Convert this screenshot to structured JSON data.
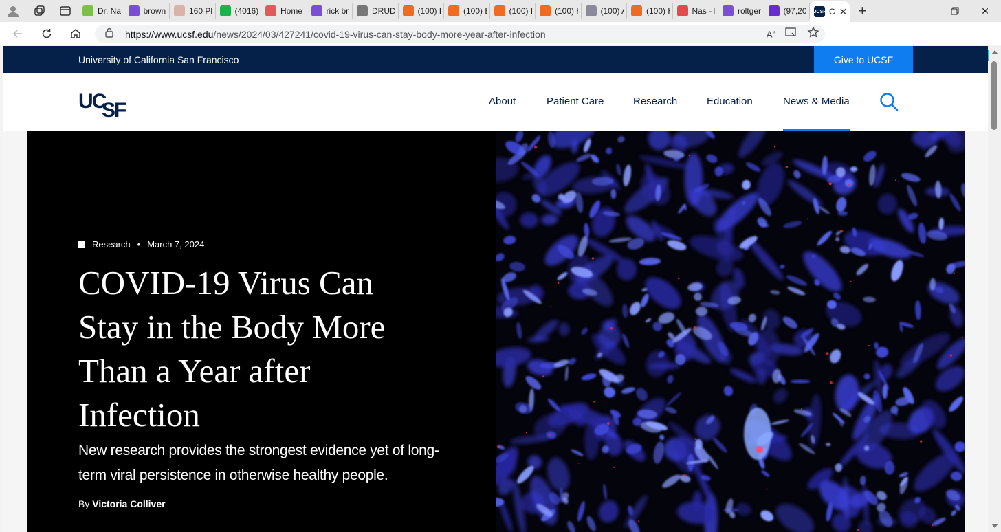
{
  "browser": {
    "tabs": [
      {
        "label": "Dr. Na",
        "color": "#7cc04b"
      },
      {
        "label": "brown",
        "color": "#7b4fd3"
      },
      {
        "label": "160 Pl",
        "color": "#d8b4a8"
      },
      {
        "label": "(4016)",
        "color": "#19b34a"
      },
      {
        "label": "Home",
        "color": "#e05a5a"
      },
      {
        "label": "rick br",
        "color": "#7b4fd3"
      },
      {
        "label": "DRUD",
        "color": "#777777"
      },
      {
        "label": "(100) H",
        "color": "#f06a22"
      },
      {
        "label": "(100) E",
        "color": "#f06a22"
      },
      {
        "label": "(100) H",
        "color": "#f06a22"
      },
      {
        "label": "(100) H",
        "color": "#f06a22"
      },
      {
        "label": "(100) A",
        "color": "#8a8a9a"
      },
      {
        "label": "(100) H",
        "color": "#f06a22"
      },
      {
        "label": "Nas - I",
        "color": "#e34b4b"
      },
      {
        "label": "roltger",
        "color": "#7b4fd3"
      },
      {
        "label": "(97,20",
        "color": "#6a2bd1"
      }
    ],
    "active_tab": {
      "label": "C",
      "favicon_text": "UCSF"
    },
    "url_host": "https://www.ucsf.edu",
    "url_path": "/news/2024/03/427241/covid-19-virus-can-stay-body-more-year-after-infection"
  },
  "site": {
    "university": "University of California San Francisco",
    "give": "Give to UCSF",
    "nav": [
      "About",
      "Patient Care",
      "Research",
      "Education",
      "News & Media"
    ],
    "active_nav": "News & Media"
  },
  "article": {
    "category": "Research",
    "separator": "•",
    "date": "March 7, 2024",
    "title": "COVID-19 Virus Can Stay in the Body More Than a Year after Infection",
    "subtitle": "New research provides the strongest evidence yet of long-term viral persistence in otherwise healthy people.",
    "byline_prefix": "By",
    "author": "Victoria Colliver"
  },
  "colors": {
    "navy": "#052049",
    "accent_blue": "#0f7cf0",
    "hero_bg": "#000000"
  }
}
